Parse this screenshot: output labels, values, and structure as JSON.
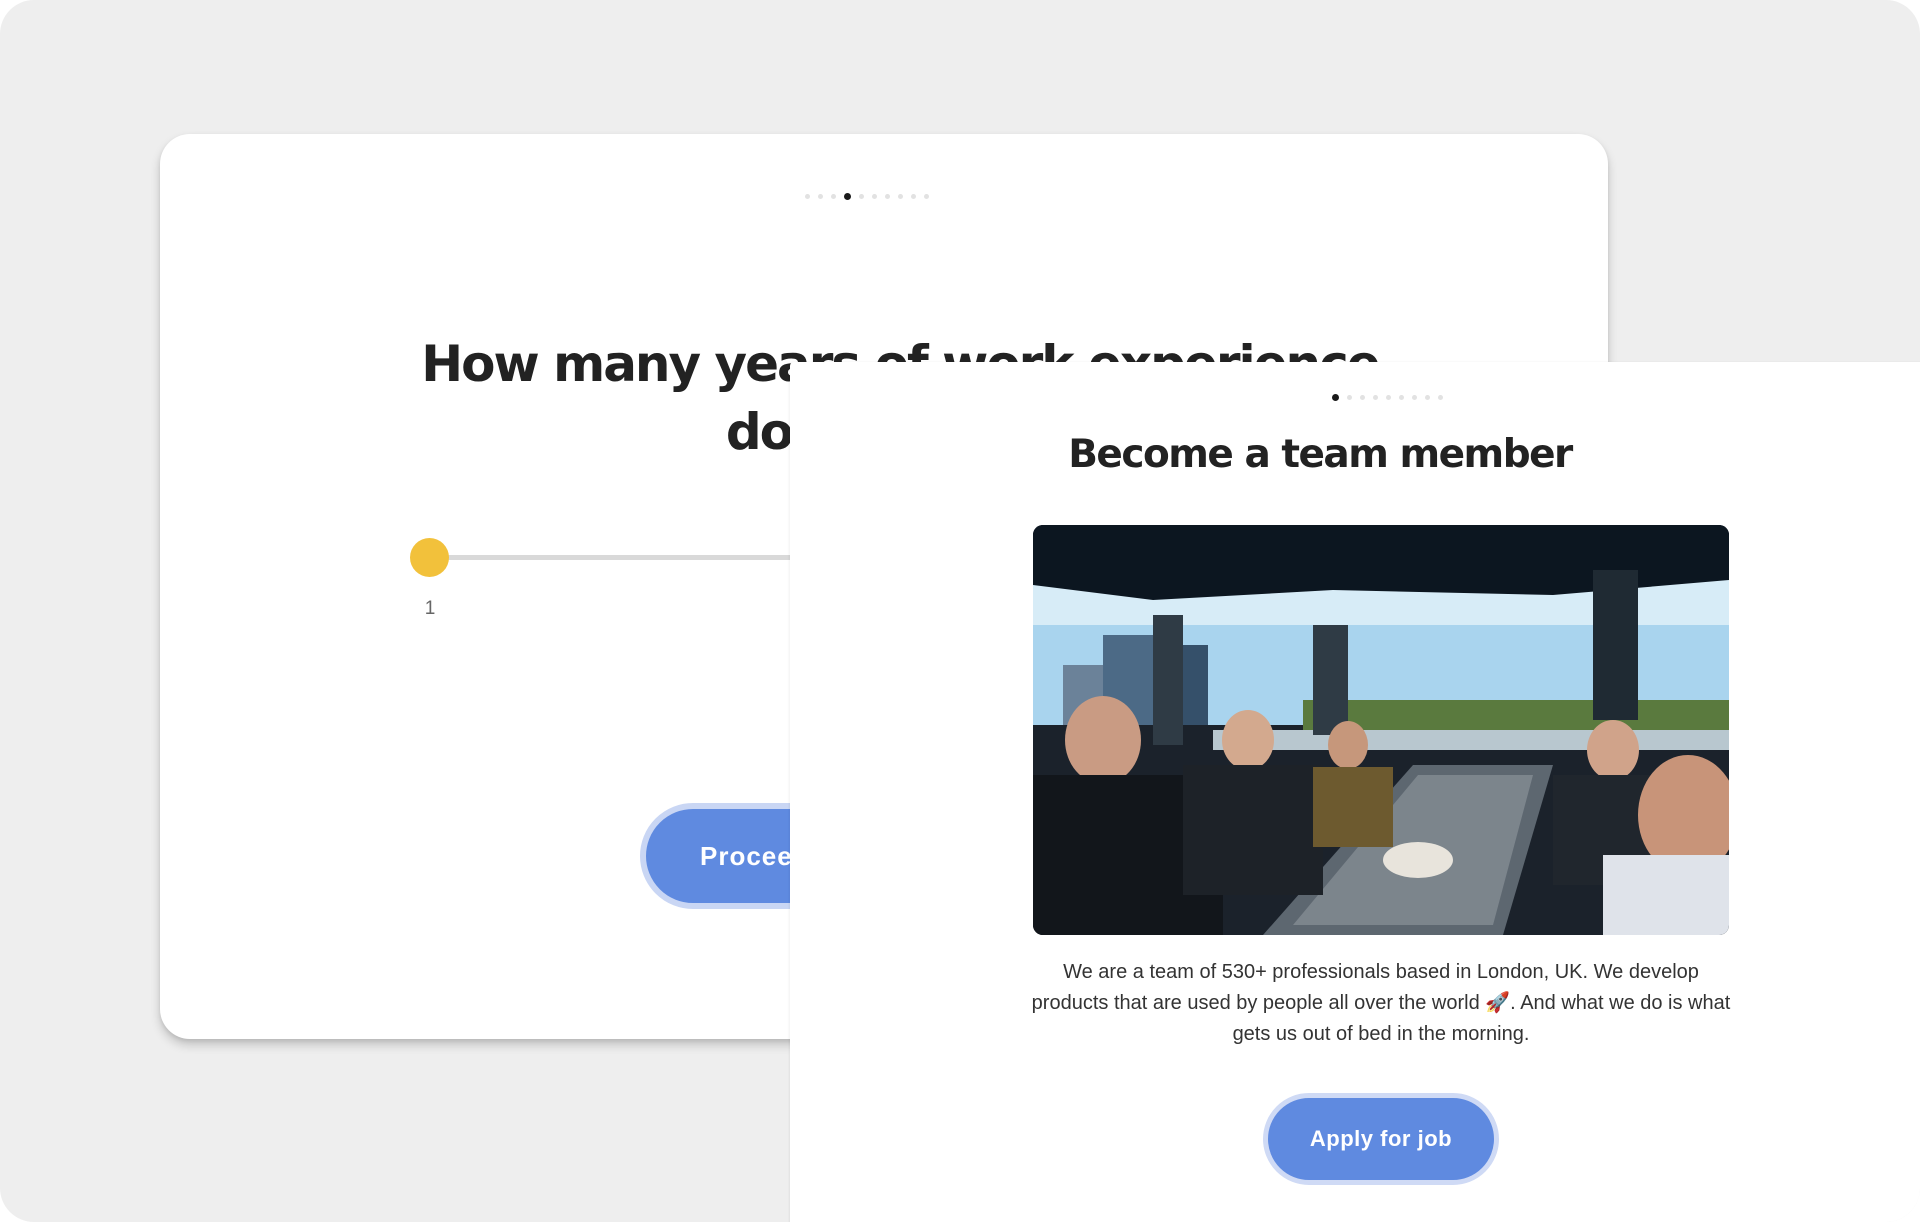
{
  "back_card": {
    "progress": {
      "total": 10,
      "active_index": 3
    },
    "question": "How many years of work experience do you have?",
    "slider": {
      "value": "1"
    },
    "proceed_label": "Proceed"
  },
  "front_card": {
    "progress": {
      "total": 9,
      "active_index": 0
    },
    "title": "Become a team member",
    "photo_alt": "team photo",
    "description": "We are a team of 530+ professionals based in London, UK. We develop products that are used by people all over the world 🚀. And what we do is what gets us out of bed in the morning.",
    "apply_label": "Apply for job"
  },
  "colors": {
    "accent": "#5f8ae0",
    "slider_handle": "#f2c13b",
    "background": "#eeeeee"
  }
}
